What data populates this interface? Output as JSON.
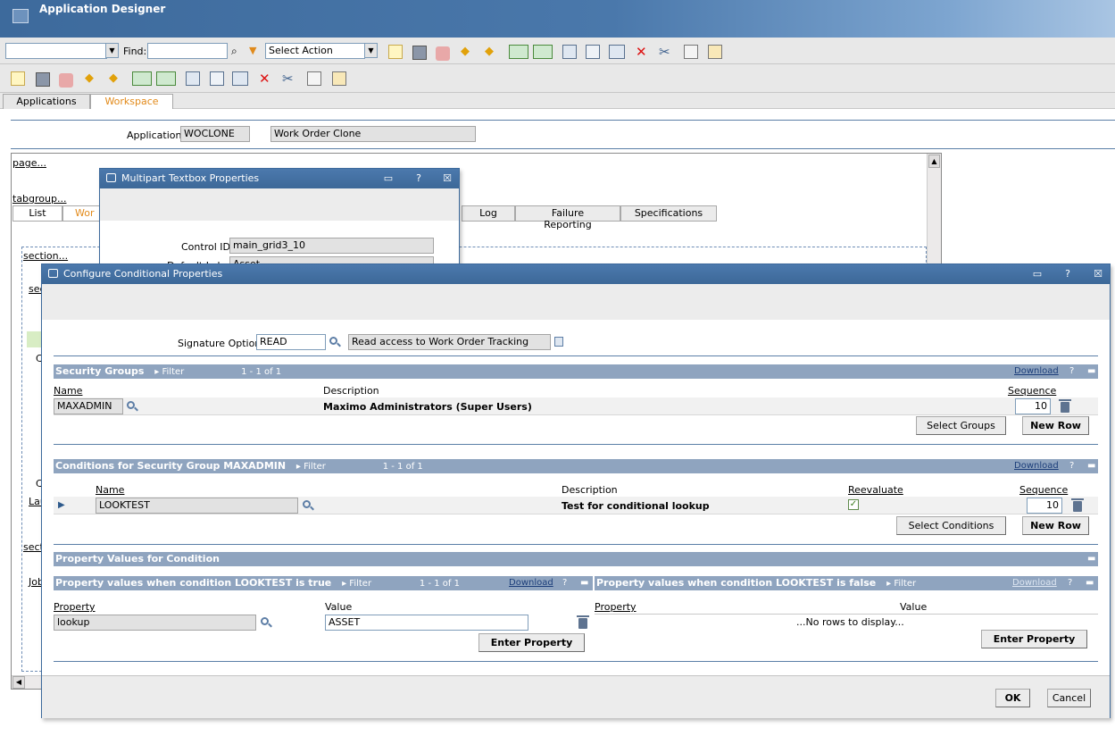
{
  "app": {
    "title": "Application Designer"
  },
  "toolbar": {
    "find_label": "Find:",
    "find_value": "",
    "select_action": "Select Action",
    "left_combo_value": ""
  },
  "main_tabs": [
    {
      "label": "Applications"
    },
    {
      "label": "Workspace"
    }
  ],
  "header": {
    "application_label": "Application",
    "application_value": "WOCLONE",
    "application_desc": "Work Order Clone"
  },
  "canvas": {
    "page_link": "page...",
    "tabgroup_link": "tabgroup...",
    "section_link": "section...",
    "section_link2": "sec",
    "sect_link": "sect",
    "job_link": "Job",
    "lau_text": "Lau",
    "c_text": "C",
    "c_text2": "C",
    "tabs": [
      {
        "label": "List"
      },
      {
        "label": "Wor"
      },
      {
        "label": "Log"
      },
      {
        "label": "Failure Reporting"
      },
      {
        "label": "Specifications"
      }
    ]
  },
  "multipart_dialog": {
    "title": "Multipart Textbox Properties",
    "control_id_label": "Control ID",
    "control_id_value": "main_grid3_10",
    "default_label_label": "Default Label",
    "default_label_value": "Asset"
  },
  "ccp_dialog": {
    "title": "Configure Conditional Properties",
    "signature_option_label": "Signature Option",
    "signature_option_value": "READ",
    "signature_option_desc": "Read access to Work Order Tracking",
    "security_groups": {
      "title": "Security Groups",
      "filter_label": "Filter",
      "count": "1 - 1 of 1",
      "download": "Download",
      "columns": {
        "name": "Name",
        "description": "Description",
        "sequence": "Sequence"
      },
      "rows": [
        {
          "name": "MAXADMIN",
          "description": "Maximo Administrators (Super Users)",
          "sequence": "10"
        }
      ],
      "select_button": "Select Groups",
      "new_row_button": "New Row"
    },
    "conditions": {
      "title": "Conditions for Security Group MAXADMIN",
      "filter_label": "Filter",
      "count": "1 - 1 of 1",
      "download": "Download",
      "columns": {
        "name": "Name",
        "description": "Description",
        "reevaluate": "Reevaluate",
        "sequence": "Sequence"
      },
      "rows": [
        {
          "name": "LOOKTEST",
          "description": "Test for conditional lookup",
          "reevaluate": true,
          "sequence": "10"
        }
      ],
      "select_button": "Select Conditions",
      "new_row_button": "New Row"
    },
    "property_values": {
      "title": "Property Values for Condition",
      "true_table": {
        "title": "Property values when condition LOOKTEST is true",
        "filter_label": "Filter",
        "count": "1 - 1 of 1",
        "download": "Download",
        "columns": {
          "property": "Property",
          "value": "Value"
        },
        "rows": [
          {
            "property": "lookup",
            "value": "ASSET"
          }
        ],
        "enter_button": "Enter Property"
      },
      "false_table": {
        "title": "Property values when condition LOOKTEST is false",
        "filter_label": "Filter",
        "download": "Download",
        "columns": {
          "property": "Property",
          "value": "Value"
        },
        "empty_text": "...No rows to display...",
        "enter_button": "Enter Property"
      }
    },
    "ok_button": "OK",
    "cancel_button": "Cancel"
  },
  "colors": {
    "title_bar": "#3d6a9c",
    "section_bar": "#8fa4bf",
    "active_tab": "#e28a1a"
  }
}
